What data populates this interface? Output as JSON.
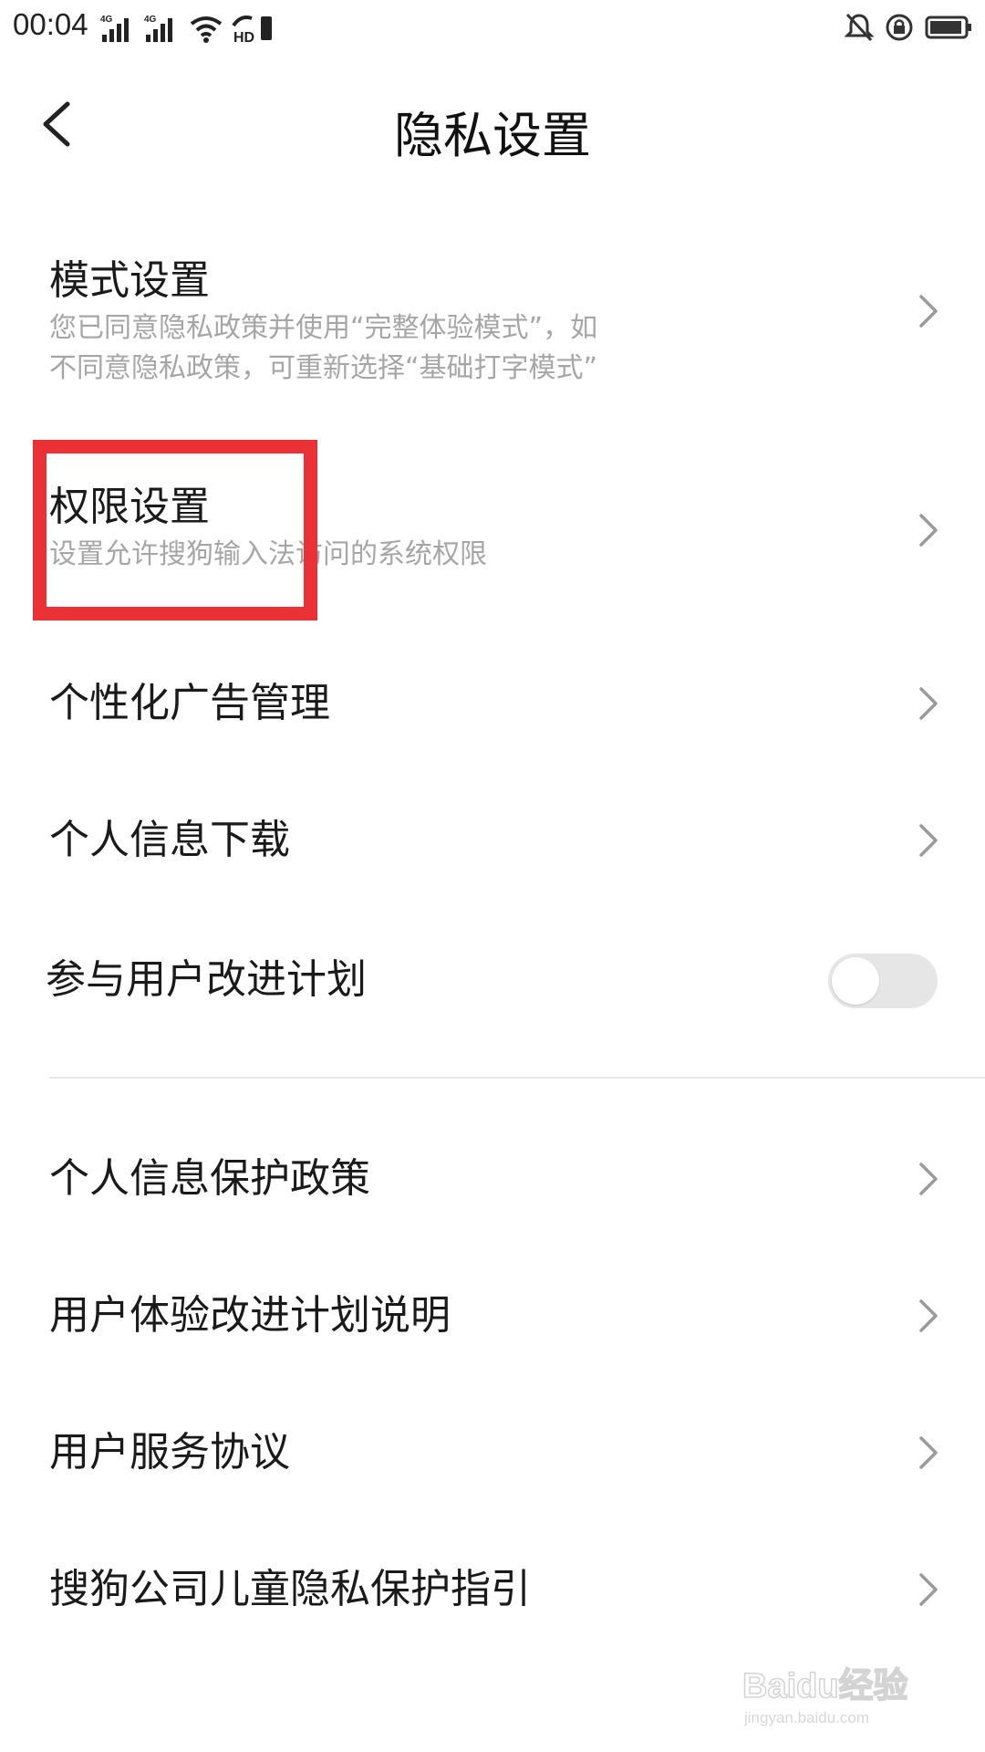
{
  "status_bar": {
    "time": "00:04",
    "network1": "4G",
    "network2": "4G",
    "hd_label": "HD"
  },
  "header": {
    "title": "隐私设置"
  },
  "items": [
    {
      "title": "模式设置",
      "subtitle_line1": "您已同意隐私政策并使用“完整体验模式”，如",
      "subtitle_line2": "不同意隐私政策，可重新选择“基础打字模式”"
    },
    {
      "title": "权限设置",
      "subtitle": "设置允许搜狗输入法访问的系统权限"
    },
    {
      "title": "个性化广告管理"
    },
    {
      "title": "个人信息下载"
    },
    {
      "title": "参与用户改进计划",
      "toggle_on": false
    },
    {
      "title": "个人信息保护政策"
    },
    {
      "title": "用户体验改进计划说明"
    },
    {
      "title": "用户服务协议"
    },
    {
      "title": "搜狗公司儿童隐私保护指引"
    }
  ],
  "watermark": {
    "brand": "Baidu经验",
    "url": "jingyan.baidu.com"
  },
  "colors": {
    "highlight": "#ea3236",
    "subtitle": "#a6a6a6",
    "toggle_off": "#e6e6e6"
  }
}
